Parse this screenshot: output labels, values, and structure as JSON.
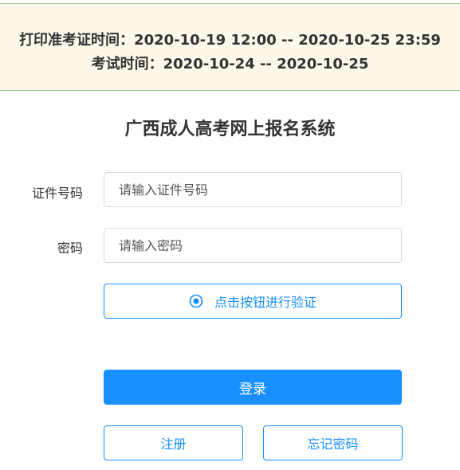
{
  "notice": {
    "print_time": "打印准考证时间：2020-10-19 12:00 -- 2020-10-25 23:59",
    "exam_time": "考试时间：2020-10-24 -- 2020-10-25"
  },
  "title": "广西成人高考网上报名系统",
  "form": {
    "id_label": "证件号码",
    "id_placeholder": "请输入证件号码",
    "password_label": "密码",
    "password_placeholder": "请输入密码",
    "verify_label": "点击按钮进行验证",
    "verify_icon": "target-icon"
  },
  "buttons": {
    "login": "登录",
    "register": "注册",
    "forgot": "忘记密码"
  },
  "colors": {
    "accent": "#1890ff",
    "notice_bg": "#fdf8ea",
    "notice_border": "#8fcf7a"
  }
}
